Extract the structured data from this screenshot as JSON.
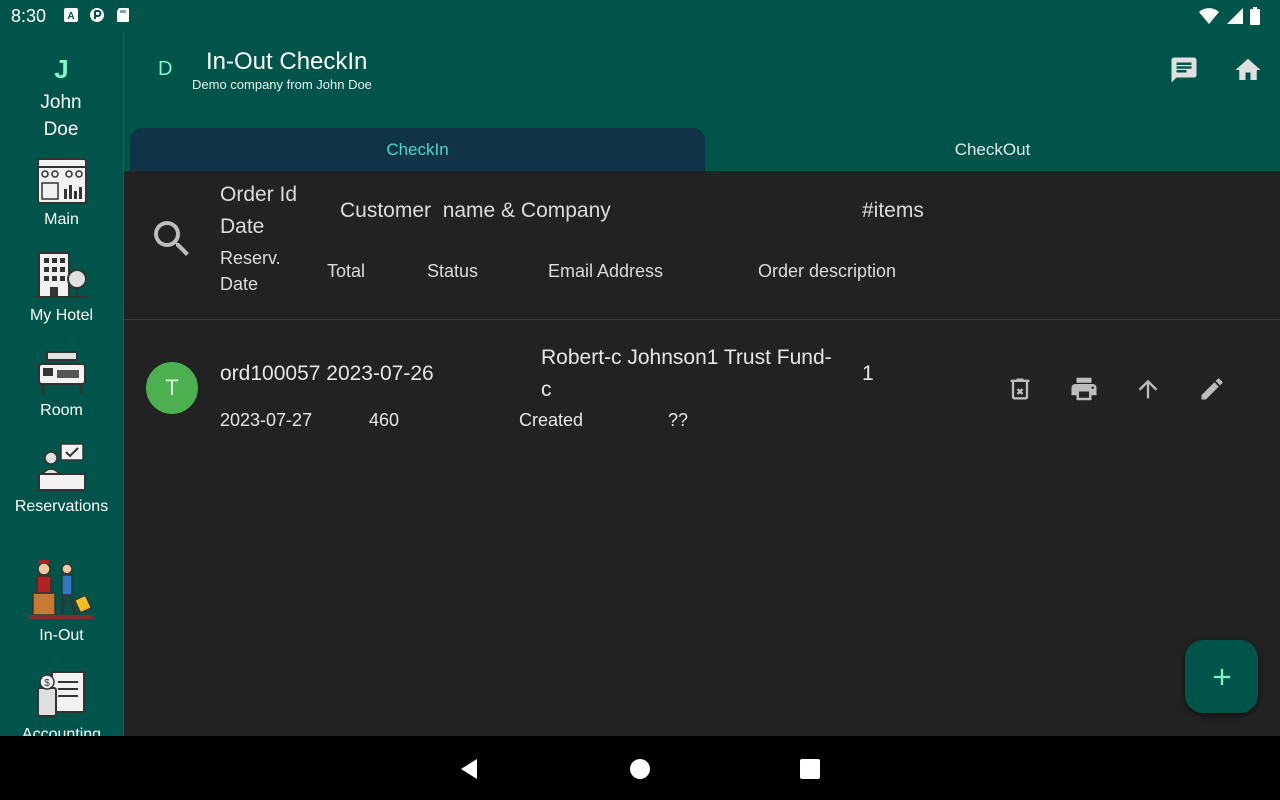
{
  "status_bar": {
    "time": "8:30",
    "left_icons": [
      "a-icon",
      "cloud-sync-icon",
      "sd-card-icon"
    ],
    "right_icons": [
      "wifi-icon",
      "signal-icon",
      "battery-icon"
    ]
  },
  "rail": {
    "user_initial": "J",
    "user_name": "John Doe",
    "items": [
      {
        "label": "Main",
        "icon": "dashboard-icon"
      },
      {
        "label": "My Hotel",
        "icon": "hotel-building-icon"
      },
      {
        "label": "Room",
        "icon": "room-icon"
      },
      {
        "label": "Reservations",
        "icon": "reservation-desk-icon"
      },
      {
        "label": "In-Out",
        "icon": "bellboy-icon"
      },
      {
        "label": "Accounting",
        "icon": "accounting-icon"
      }
    ]
  },
  "appbar": {
    "company_initial": "D",
    "title": "In-Out CheckIn",
    "subtitle": "Demo company from John Doe",
    "actions": [
      "chat-icon",
      "home-icon"
    ]
  },
  "tabs": [
    {
      "label": "CheckIn",
      "active": true
    },
    {
      "label": "CheckOut",
      "active": false
    }
  ],
  "header": {
    "order_id": "Order Id",
    "date": "Date",
    "customer": "Customer  name & Company",
    "items": "#items",
    "reserv": "Reserv.",
    "reserv_date": "Date",
    "total": "Total",
    "status": "Status",
    "email": "Email Address",
    "description": "Order description"
  },
  "orders": [
    {
      "avatar": "T",
      "id_date": "ord100057 2023-07-26",
      "customer": "Robert-c Johnson1 Trust Fund-",
      "customer_cont": "c",
      "items": "1",
      "reserv_date": "2023-07-27",
      "total": "460",
      "status": "Created",
      "description": "??"
    }
  ],
  "row_actions": [
    "delete-icon",
    "print-icon",
    "arrow-up-icon",
    "edit-icon"
  ],
  "fab_icon": "plus-icon",
  "colors": {
    "primary": "#00544a",
    "accent": "#4fd6c2",
    "tab_active_bg": "#103446",
    "background": "#222222",
    "avatar": "#4caf50"
  },
  "nav_bar": [
    "back-icon",
    "home-circle-icon",
    "recents-icon"
  ]
}
